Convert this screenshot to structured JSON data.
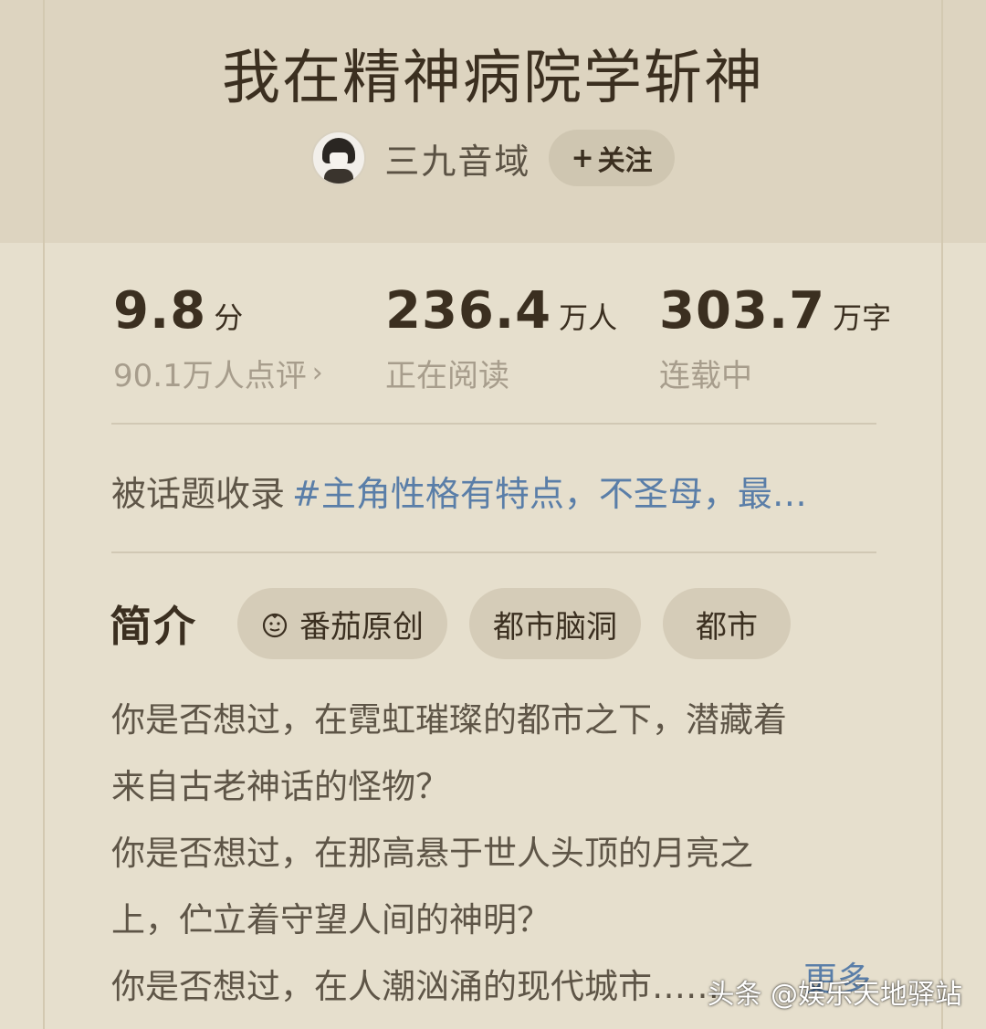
{
  "book": {
    "title": "我在精神病院学斩神"
  },
  "author": {
    "name": "三九音域",
    "follow_plus": "+",
    "follow_label": "关注"
  },
  "stats": {
    "rating": {
      "value": "9.8",
      "unit": "分",
      "label": "90.1万人点评",
      "chevron": "›"
    },
    "readers": {
      "value": "236.4",
      "unit": "万人",
      "label": "正在阅读"
    },
    "words": {
      "value": "303.7",
      "unit": "万字",
      "label": "连载中"
    }
  },
  "topic": {
    "prefix": "被话题收录",
    "link": "#主角性格有特点，不圣母，最…"
  },
  "intro": {
    "heading": "简介",
    "tags": [
      "番茄原创",
      "都市脑洞",
      "都市"
    ],
    "tag_icon": "tomato-original-icon"
  },
  "synopsis": {
    "lines": [
      "你是否想过，在霓虹璀璨的都市之下，潜藏着",
      "来自古老神话的怪物？",
      "你是否想过，在那高悬于世人头顶的月亮之",
      "上，伫立着守望人间的神明？",
      "你是否想过，在人潮汹涌的现代城市……"
    ],
    "more": "更多"
  },
  "watermark": "头条 @娱乐天地驿站",
  "colors": {
    "background": "#e6dfcd",
    "header": "#ddd4c0",
    "title": "#3b2f20",
    "link": "#5a7ea8",
    "muted": "#a79d8c"
  }
}
